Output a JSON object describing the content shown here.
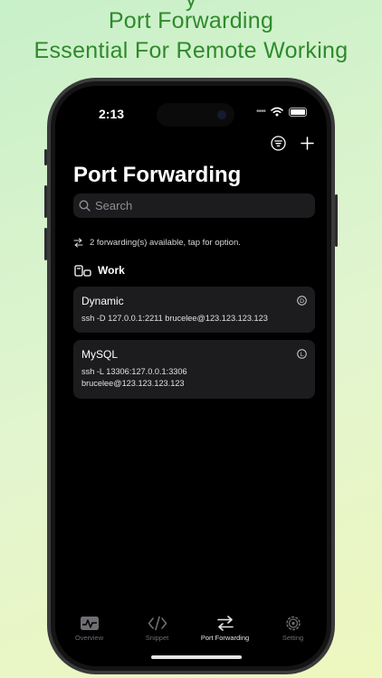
{
  "promo": {
    "line_cut": "y",
    "line1": "Port Forwarding",
    "line2": "Essential For Remote Working"
  },
  "status_bar": {
    "time": "2:13",
    "dots": "••••"
  },
  "page": {
    "title": "Port Forwarding",
    "search_placeholder": "Search",
    "info": "2 forwarding(s) available, tap for option.",
    "group": "Work"
  },
  "forwardings": [
    {
      "name": "Dynamic",
      "command": "ssh -D 127.0.0.1:2211 brucelee@123.123.123.123",
      "badge": "D"
    },
    {
      "name": "MySQL",
      "command_line1": "ssh -L 13306:127.0.0.1:3306",
      "command_line2": "brucelee@123.123.123.123",
      "badge": "L"
    }
  ],
  "tabs": [
    {
      "label": "Overview",
      "icon": "pulse-icon"
    },
    {
      "label": "Snippet",
      "icon": "code-icon"
    },
    {
      "label": "Port Forwarding",
      "icon": "arrows-exchange-icon"
    },
    {
      "label": "Setting",
      "icon": "gear-icon"
    }
  ],
  "active_tab": "Port Forwarding",
  "colors": {
    "accent": "#2f8a2c",
    "card": "#1c1c1e",
    "inactive_tab": "#6e6e73"
  }
}
